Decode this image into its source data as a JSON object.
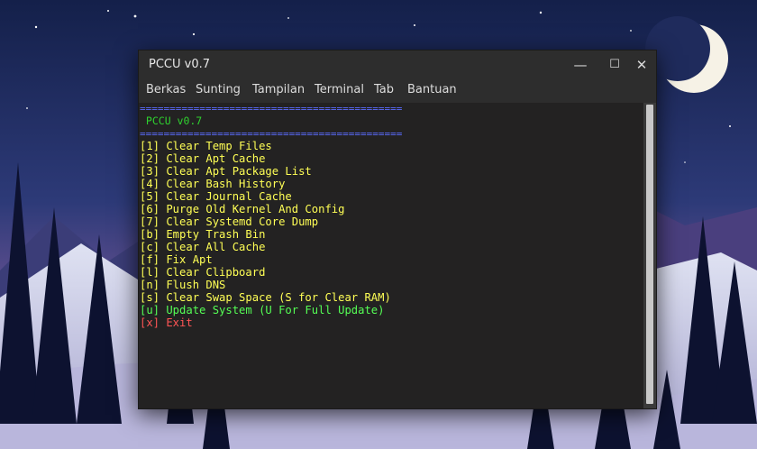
{
  "window": {
    "title": "PCCU v0.7",
    "controls": {
      "minimize": "—",
      "maximize": "☐",
      "close": "✕"
    }
  },
  "menubar": [
    "Berkas",
    "Sunting",
    "Tampilan",
    "Terminal",
    "Tab",
    "Bantuan"
  ],
  "terminal": {
    "separator": "============================================",
    "header": " PCCU v0.7",
    "options": [
      "[1] Clear Temp Files",
      "[2] Clear Apt Cache",
      "[3] Clear Apt Package List",
      "[4] Clear Bash History",
      "[5] Clear Journal Cache",
      "[6] Purge Old Kernel And Config",
      "[7] Clear Systemd Core Dump",
      "[b] Empty Trash Bin",
      "[c] Clear All Cache",
      "[f] Fix Apt",
      "[l] Clear Clipboard",
      "[n] Flush DNS",
      "[s] Clear Swap Space (S for Clear RAM)"
    ],
    "update_option": "[u] Update System (U For Full Update)",
    "exit_option": "[x] Exit"
  },
  "colors": {
    "separator": "#5a6cff",
    "header": "#2fd22f",
    "option": "#ffff55",
    "update": "#55ff55",
    "exit": "#ff5555"
  }
}
